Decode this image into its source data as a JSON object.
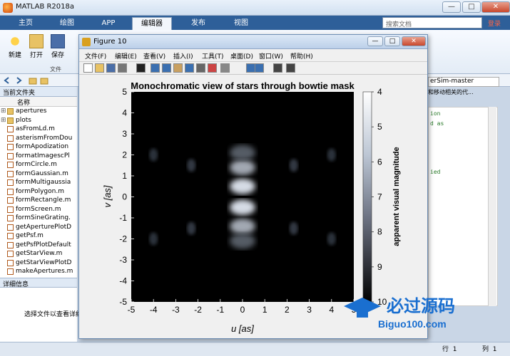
{
  "app": {
    "title": "MATLAB R2018a",
    "minimize": "—",
    "maximize": "□",
    "close": "✕"
  },
  "tabs": [
    "主页",
    "绘图",
    "APP",
    "编辑器",
    "发布",
    "视图"
  ],
  "search_placeholder": "搜索文档",
  "login": "登录",
  "ribbon": {
    "new": "新建",
    "open": "打开",
    "save": "保存",
    "group": "文件"
  },
  "file_browser": {
    "header": "当前文件夹",
    "column": "名称",
    "items": [
      {
        "name": "apertures",
        "type": "folder"
      },
      {
        "name": "plots",
        "type": "folder"
      },
      {
        "name": "asFromLd.m",
        "type": "m"
      },
      {
        "name": "asterismFromDou",
        "type": "m"
      },
      {
        "name": "formApodization",
        "type": "m"
      },
      {
        "name": "formatImagescPl",
        "type": "m"
      },
      {
        "name": "formCircle.m",
        "type": "m"
      },
      {
        "name": "formGaussian.m",
        "type": "m"
      },
      {
        "name": "formMultigaussia",
        "type": "m"
      },
      {
        "name": "formPolygon.m",
        "type": "m"
      },
      {
        "name": "formRectangle.m",
        "type": "m"
      },
      {
        "name": "formScreen.m",
        "type": "m"
      },
      {
        "name": "formSineGrating.",
        "type": "m"
      },
      {
        "name": "getAperturePlotD",
        "type": "m"
      },
      {
        "name": "getPsf.m",
        "type": "m"
      },
      {
        "name": "getPsfPlotDefault",
        "type": "m"
      },
      {
        "name": "getStarView.m",
        "type": "m"
      },
      {
        "name": "getStarViewPlotD",
        "type": "m"
      },
      {
        "name": "makeApertures.m",
        "type": "m"
      }
    ]
  },
  "details": {
    "header": "详细信息",
    "hint": "选择文件以查看详细"
  },
  "right_panel": {
    "address": "erSim-master",
    "description": "和移动相关的代...",
    "code": [
      "ion",
      "d as",
      "ied"
    ]
  },
  "status": {
    "row_label": "行",
    "row": "1",
    "col_label": "列",
    "col": "1"
  },
  "figure": {
    "title": "Figure 10",
    "menu": [
      "文件(F)",
      "编辑(E)",
      "查看(V)",
      "插入(I)",
      "工具(T)",
      "桌面(D)",
      "窗口(W)",
      "帮助(H)"
    ],
    "toolbar_icons": [
      "new-figure-icon",
      "open-icon",
      "save-icon",
      "print-icon",
      "pointer-icon",
      "zoom-in-icon",
      "zoom-out-icon",
      "pan-icon",
      "rotate-icon",
      "data-cursor-icon",
      "brush-icon",
      "link-icon",
      "colorbar-icon",
      "legend-icon",
      "hide-tools-icon",
      "dock-icon"
    ]
  },
  "chart_data": {
    "type": "heatmap",
    "title": "Monochromatic view of stars through bowtie mask",
    "xlabel": "u [as]",
    "ylabel": "v [as]",
    "xlim": [
      -5,
      5
    ],
    "ylim": [
      -5,
      5
    ],
    "xticks": [
      "-5",
      "-4",
      "-3",
      "-2",
      "-1",
      "0",
      "1",
      "2",
      "3",
      "4",
      "5"
    ],
    "yticks": [
      "5",
      "4",
      "3",
      "2",
      "1",
      "0",
      "-1",
      "-2",
      "-3",
      "-4",
      "-5"
    ],
    "colorbar": {
      "label": "apparent visual magnitude",
      "ticks": [
        "4",
        "5",
        "6",
        "7",
        "8",
        "9",
        "10"
      ],
      "range": [
        4,
        10
      ],
      "colormap": "bone-reversed"
    },
    "blobs": [
      {
        "u": 0,
        "v": 1.4,
        "mag": 6.2
      },
      {
        "u": 0,
        "v": 0.5,
        "mag": 5.0
      },
      {
        "u": 0,
        "v": -0.5,
        "mag": 5.0
      },
      {
        "u": 0,
        "v": -1.4,
        "mag": 6.2
      },
      {
        "u": 0,
        "v": 2.1,
        "mag": 8.0
      },
      {
        "u": 0,
        "v": -2.1,
        "mag": 8.0
      },
      {
        "u": -2.3,
        "v": 1.5,
        "mag": 8.8
      },
      {
        "u": 2.3,
        "v": 1.5,
        "mag": 8.8
      },
      {
        "u": -2.3,
        "v": -1.5,
        "mag": 8.8
      },
      {
        "u": 2.3,
        "v": -1.5,
        "mag": 8.8
      },
      {
        "u": -4.0,
        "v": 2.0,
        "mag": 9.0
      },
      {
        "u": 4.0,
        "v": 2.0,
        "mag": 9.0
      },
      {
        "u": -4.0,
        "v": -2.0,
        "mag": 9.0
      },
      {
        "u": 4.0,
        "v": -2.0,
        "mag": 9.0
      }
    ]
  },
  "watermark": {
    "text": "必过源码",
    "url": "Biguo100.com"
  }
}
